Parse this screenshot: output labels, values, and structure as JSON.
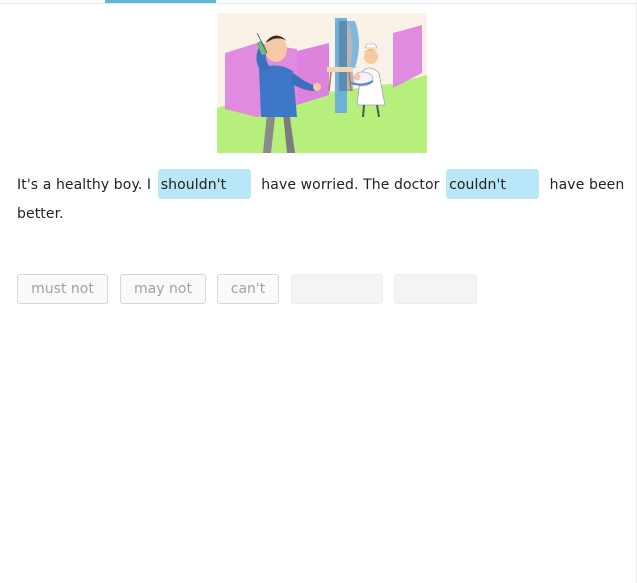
{
  "exercise": {
    "sentence_parts": [
      "It's a healthy boy. I",
      "have worried. The doctor",
      "have been better."
    ],
    "slots": [
      {
        "value": "shouldn't"
      },
      {
        "value": "couldn't"
      }
    ]
  },
  "word_bank": [
    {
      "label": "must not"
    },
    {
      "label": "may not"
    },
    {
      "label": "can't"
    },
    {
      "label": ""
    },
    {
      "label": ""
    }
  ],
  "colors": {
    "accent": "#5bb8d8",
    "slot_fill": "#b9e6f8",
    "chip_border": "#d7d7d7",
    "chip_text": "#a2a2a2"
  }
}
